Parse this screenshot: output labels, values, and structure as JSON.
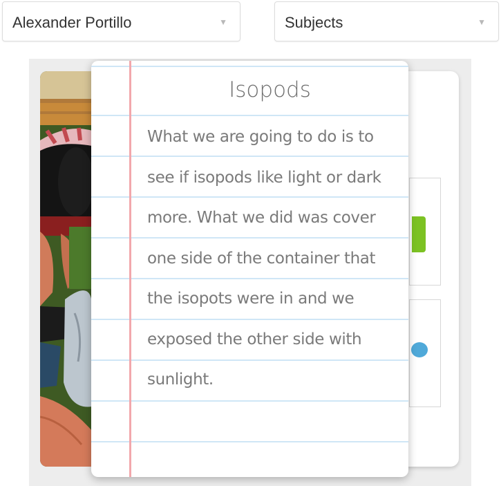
{
  "filters": {
    "student": {
      "selected": "Alexander Portillo"
    },
    "subject": {
      "selected": "Subjects"
    }
  },
  "entry": {
    "title": "Isopods",
    "text": "What we are going to do is to see if isopods like light or dark more. What we did was cover one side of the container that the isopots were in and we exposed the other side with sunlight."
  },
  "icons": {
    "dropdown": "chevron-down-icon"
  },
  "colors": {
    "margin_line": "#f2a8ac",
    "ruled_line": "#cfe6f6",
    "card_green": "#7cc223",
    "card_blue": "#4fa9d9",
    "stage_background": "#ededed"
  }
}
